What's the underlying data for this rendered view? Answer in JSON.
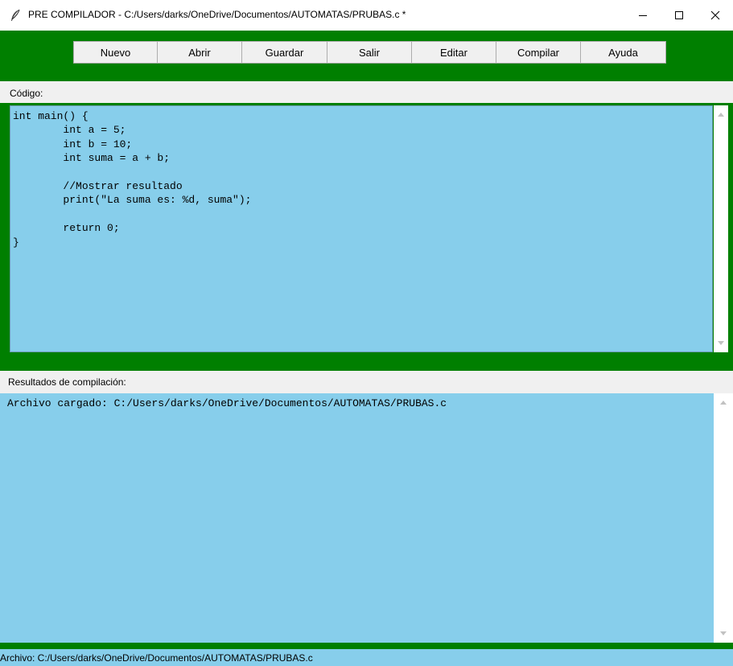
{
  "window": {
    "title": "PRE COMPILADOR - C:/Users/darks/OneDrive/Documentos/AUTOMATAS/PRUBAS.c *",
    "icon": "feather-icon",
    "controls": [
      "minimize-icon",
      "maximize-icon",
      "close-icon"
    ]
  },
  "toolbar": {
    "buttons": [
      "Nuevo",
      "Abrir",
      "Guardar",
      "Salir",
      "Editar",
      "Compilar",
      "Ayuda"
    ],
    "background": "#007f00"
  },
  "editor": {
    "label": "Código:",
    "content": "int main() {\n        int a = 5;\n        int b = 10;\n        int suma = a + b;\n\n        //Mostrar resultado\n        print(\"La suma es: %d, suma\");\n\n        return 0;\n}",
    "background": "#87ceeb"
  },
  "results": {
    "label": "Resultados de compilación:",
    "content": "Archivo cargado: C:/Users/darks/OneDrive/Documentos/AUTOMATAS/PRUBAS.c"
  },
  "status_bar": {
    "text": "Archivo: C:/Users/darks/OneDrive/Documentos/AUTOMATAS/PRUBAS.c"
  }
}
